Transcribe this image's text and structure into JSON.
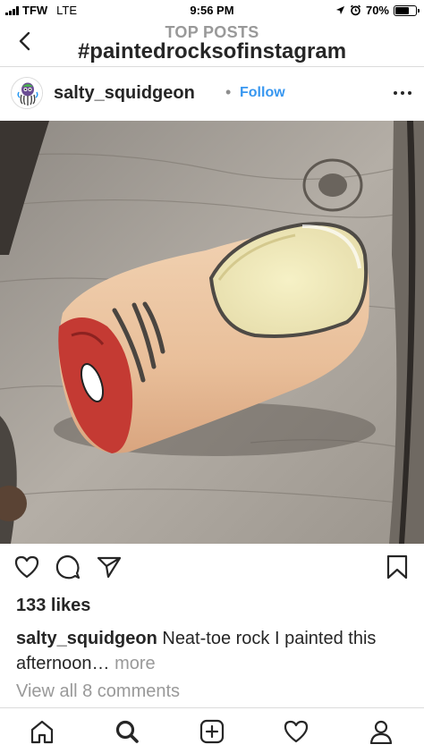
{
  "status_bar": {
    "carrier": "TFW",
    "network": "LTE",
    "time": "9:56 PM",
    "battery_percent": "70%",
    "battery_level": 0.7
  },
  "header": {
    "subtitle": "TOP POSTS",
    "title": "#paintedrocksofinstagram"
  },
  "post": {
    "username": "salty_squidgeon",
    "follow_label": "Follow",
    "separator": "•",
    "likes": "133 likes",
    "caption_user": "salty_squidgeon",
    "caption_text": " Neat-toe rock I painted this afternoon…",
    "caption_more": " more",
    "view_comments": "View all 8 comments",
    "photo_subject": "painted rock shaped like a severed toe on weathered wood"
  },
  "icons": {
    "back": "chevron-left-icon",
    "more": "more-dots-icon",
    "like": "heart-icon",
    "comment": "comment-icon",
    "share": "paper-plane-icon",
    "save": "bookmark-icon",
    "home": "home-icon",
    "search": "search-icon",
    "add": "add-post-icon",
    "activity": "heart-icon",
    "profile": "profile-icon"
  },
  "colors": {
    "link_blue": "#3897f0",
    "muted_gray": "#999999",
    "text": "#262626",
    "divider": "#dbdbdb"
  }
}
